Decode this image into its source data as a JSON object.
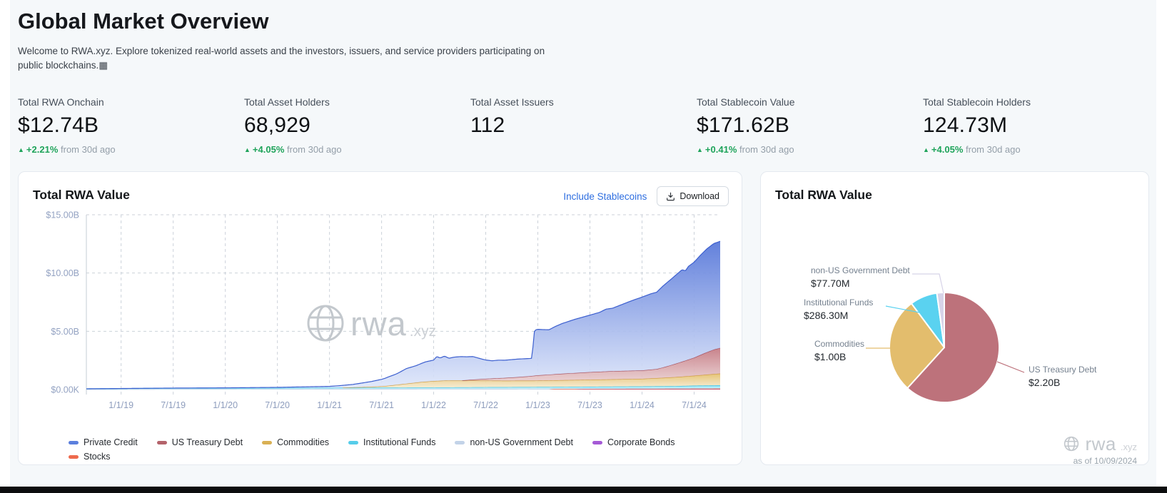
{
  "header": {
    "title": "Global Market Overview",
    "subtitle_line1": "Welcome to RWA.xyz. Explore tokenized real-world assets and the investors, issuers, and service providers participating on",
    "subtitle_line2": "public blockchains.▦"
  },
  "stats": [
    {
      "label": "Total RWA Onchain",
      "value": "$12.74B",
      "delta": "+2.21%",
      "delta_suffix": "from 30d ago"
    },
    {
      "label": "Total Asset Holders",
      "value": "68,929",
      "delta": "+4.05%",
      "delta_suffix": "from 30d ago"
    },
    {
      "label": "Total Asset Issuers",
      "value": "112"
    },
    {
      "label": "Total Stablecoin Value",
      "value": "$171.62B",
      "delta": "+0.41%",
      "delta_suffix": "from 30d ago"
    },
    {
      "label": "Total Stablecoin Holders",
      "value": "124.73M",
      "delta": "+4.05%",
      "delta_suffix": "from 30d ago"
    }
  ],
  "colors": {
    "positive": "#1ea35a",
    "link": "#2e6ee0"
  },
  "area_card": {
    "title": "Total RWA Value",
    "link_label": "Include Stablecoins",
    "download_label": "Download",
    "watermark": "rwa",
    "watermark_suffix": ".xyz"
  },
  "pie_card": {
    "title": "Total RWA Value",
    "watermark": "rwa",
    "watermark_suffix": ".xyz",
    "as_of": "as of 10/09/2024"
  },
  "chart_data": [
    {
      "type": "area",
      "title": "Total RWA Value",
      "stacked": true,
      "units": "$ billions",
      "ymax": 15,
      "y_ticks": [
        {
          "v": 0,
          "label": "$0.00K"
        },
        {
          "v": 5,
          "label": "$5.00B"
        },
        {
          "v": 10,
          "label": "$10.00B"
        },
        {
          "v": 15,
          "label": "$15.00B"
        }
      ],
      "x_ticks": [
        {
          "f": 0.0548,
          "label": "1/1/19"
        },
        {
          "f": 0.137,
          "label": "7/1/19"
        },
        {
          "f": 0.2192,
          "label": "1/1/20"
        },
        {
          "f": 0.3014,
          "label": "7/1/20"
        },
        {
          "f": 0.3836,
          "label": "1/1/21"
        },
        {
          "f": 0.4658,
          "label": "7/1/21"
        },
        {
          "f": 0.5479,
          "label": "1/1/22"
        },
        {
          "f": 0.6301,
          "label": "7/1/22"
        },
        {
          "f": 0.7123,
          "label": "1/1/23"
        },
        {
          "f": 0.7945,
          "label": "7/1/23"
        },
        {
          "f": 0.8767,
          "label": "1/1/24"
        },
        {
          "f": 0.9589,
          "label": "7/1/24"
        }
      ],
      "series": [
        {
          "name": "non-US Government Debt",
          "stroke": "#b3c6e0",
          "top": "#c9d7ea",
          "bottom": "#e9eff7",
          "points": [
            [
              0,
              0.02
            ],
            [
              0.2,
              0.03
            ],
            [
              0.4,
              0.045
            ],
            [
              0.6,
              0.05
            ],
            [
              0.8,
              0.065
            ],
            [
              1,
              0.08
            ]
          ]
        },
        {
          "name": "Institutional Funds",
          "stroke": "#3ec3e6",
          "top": "#74daf2",
          "bottom": "#d8f4fb",
          "points": [
            [
              0,
              0.04
            ],
            [
              0.055,
              0.06
            ],
            [
              0.137,
              0.09
            ],
            [
              0.3,
              0.1
            ],
            [
              0.466,
              0.12
            ],
            [
              0.548,
              0.13
            ],
            [
              0.63,
              0.15
            ],
            [
              0.712,
              0.16
            ],
            [
              0.795,
              0.18
            ],
            [
              0.877,
              0.2
            ],
            [
              0.93,
              0.22
            ],
            [
              0.959,
              0.26
            ],
            [
              1,
              0.29
            ]
          ]
        },
        {
          "name": "Commodities",
          "stroke": "#cf9c3e",
          "top": "#e4c06e",
          "bottom": "#f7eed6",
          "points": [
            [
              0,
              0
            ],
            [
              0.4,
              0
            ],
            [
              0.43,
              0.04
            ],
            [
              0.47,
              0.12
            ],
            [
              0.5,
              0.3
            ],
            [
              0.53,
              0.48
            ],
            [
              0.548,
              0.55
            ],
            [
              0.57,
              0.6
            ],
            [
              0.6,
              0.58
            ],
            [
              0.63,
              0.57
            ],
            [
              0.66,
              0.55
            ],
            [
              0.712,
              0.55
            ],
            [
              0.795,
              0.6
            ],
            [
              0.877,
              0.65
            ],
            [
              0.91,
              0.72
            ],
            [
              0.94,
              0.8
            ],
            [
              0.959,
              0.85
            ],
            [
              0.985,
              0.95
            ],
            [
              1,
              1.0
            ]
          ]
        },
        {
          "name": "US Treasury Debt",
          "stroke": "#a84e59",
          "top": "#c57c85",
          "bottom": "#f0dede",
          "points": [
            [
              0,
              0
            ],
            [
              0.59,
              0
            ],
            [
              0.61,
              0.08
            ],
            [
              0.64,
              0.18
            ],
            [
              0.68,
              0.3
            ],
            [
              0.7,
              0.38
            ],
            [
              0.712,
              0.45
            ],
            [
              0.75,
              0.55
            ],
            [
              0.795,
              0.65
            ],
            [
              0.83,
              0.7
            ],
            [
              0.877,
              0.72
            ],
            [
              0.9,
              0.78
            ],
            [
              0.915,
              0.95
            ],
            [
              0.93,
              1.15
            ],
            [
              0.945,
              1.35
            ],
            [
              0.959,
              1.55
            ],
            [
              0.975,
              1.85
            ],
            [
              0.99,
              2.1
            ],
            [
              1,
              2.2
            ]
          ]
        },
        {
          "name": "Private Credit",
          "stroke": "#3c5fcf",
          "top": "#5a7ada",
          "bottom": "#dfe7fa",
          "points": [
            [
              0,
              0.005
            ],
            [
              0.137,
              0.01
            ],
            [
              0.219,
              0.02
            ],
            [
              0.301,
              0.05
            ],
            [
              0.384,
              0.12
            ],
            [
              0.42,
              0.25
            ],
            [
              0.45,
              0.45
            ],
            [
              0.466,
              0.6
            ],
            [
              0.49,
              0.95
            ],
            [
              0.505,
              1.3
            ],
            [
              0.52,
              1.45
            ],
            [
              0.535,
              1.7
            ],
            [
              0.548,
              1.8
            ],
            [
              0.553,
              2.1
            ],
            [
              0.558,
              1.95
            ],
            [
              0.565,
              2.1
            ],
            [
              0.572,
              1.9
            ],
            [
              0.58,
              2.0
            ],
            [
              0.59,
              2.05
            ],
            [
              0.6,
              2.0
            ],
            [
              0.61,
              1.98
            ],
            [
              0.625,
              1.7
            ],
            [
              0.63,
              1.62
            ],
            [
              0.64,
              1.52
            ],
            [
              0.65,
              1.55
            ],
            [
              0.66,
              1.52
            ],
            [
              0.68,
              1.55
            ],
            [
              0.7,
              1.52
            ],
            [
              0.703,
              1.52
            ],
            [
              0.707,
              3.9
            ],
            [
              0.712,
              3.95
            ],
            [
              0.72,
              3.9
            ],
            [
              0.73,
              3.85
            ],
            [
              0.74,
              4.1
            ],
            [
              0.75,
              4.3
            ],
            [
              0.77,
              4.6
            ],
            [
              0.795,
              4.9
            ],
            [
              0.81,
              5.1
            ],
            [
              0.82,
              5.35
            ],
            [
              0.83,
              5.4
            ],
            [
              0.85,
              5.8
            ],
            [
              0.86,
              6.0
            ],
            [
              0.877,
              6.3
            ],
            [
              0.89,
              6.5
            ],
            [
              0.9,
              6.6
            ],
            [
              0.91,
              7.0
            ],
            [
              0.92,
              7.3
            ],
            [
              0.93,
              7.6
            ],
            [
              0.94,
              7.9
            ],
            [
              0.945,
              7.7
            ],
            [
              0.95,
              8.0
            ],
            [
              0.959,
              8.2
            ],
            [
              0.97,
              8.6
            ],
            [
              0.98,
              8.9
            ],
            [
              0.99,
              9.1
            ],
            [
              1,
              9.15
            ]
          ]
        }
      ],
      "overlays": [
        {
          "name": "Stocks",
          "color": "#ee6a4d",
          "points": [
            [
              0.73,
              0
            ],
            [
              0.737,
              0.05
            ],
            [
              0.8,
              0.06
            ],
            [
              0.9,
              0.07
            ],
            [
              1,
              0.09
            ]
          ]
        },
        {
          "name": "Corporate Bonds",
          "color": "#b2497e",
          "points": [
            [
              0.77,
              0
            ],
            [
              0.778,
              0.03
            ],
            [
              0.9,
              0.04
            ],
            [
              1,
              0.05
            ]
          ]
        }
      ],
      "legend": [
        {
          "label": "Private Credit",
          "color": "#5b7fdd"
        },
        {
          "label": "US Treasury Debt",
          "color": "#b4636b"
        },
        {
          "label": "Commodities",
          "color": "#d9b054"
        },
        {
          "label": "Institutional Funds",
          "color": "#56cdea"
        },
        {
          "label": "non-US Government Debt",
          "color": "#c3d3e8"
        },
        {
          "label": "Corporate Bonds",
          "color": "#a55ad6"
        },
        {
          "label": "Stocks",
          "color": "#ee6a4d"
        }
      ]
    },
    {
      "type": "pie",
      "title": "Total RWA Value",
      "slices": [
        {
          "label": "US Treasury Debt",
          "value_label": "$2.20B",
          "value_musd": 2200,
          "color": "#bd727b"
        },
        {
          "label": "Commodities",
          "value_label": "$1.00B",
          "value_musd": 1000,
          "color": "#e3bd6d"
        },
        {
          "label": "Institutional Funds",
          "value_label": "$286.30M",
          "value_musd": 286.3,
          "color": "#5ad2f0"
        },
        {
          "label": "non-US Government Debt",
          "value_label": "$77.70M",
          "value_musd": 77.7,
          "color": "#d7d3e8"
        }
      ],
      "as_of": "as of 10/09/2024"
    }
  ]
}
